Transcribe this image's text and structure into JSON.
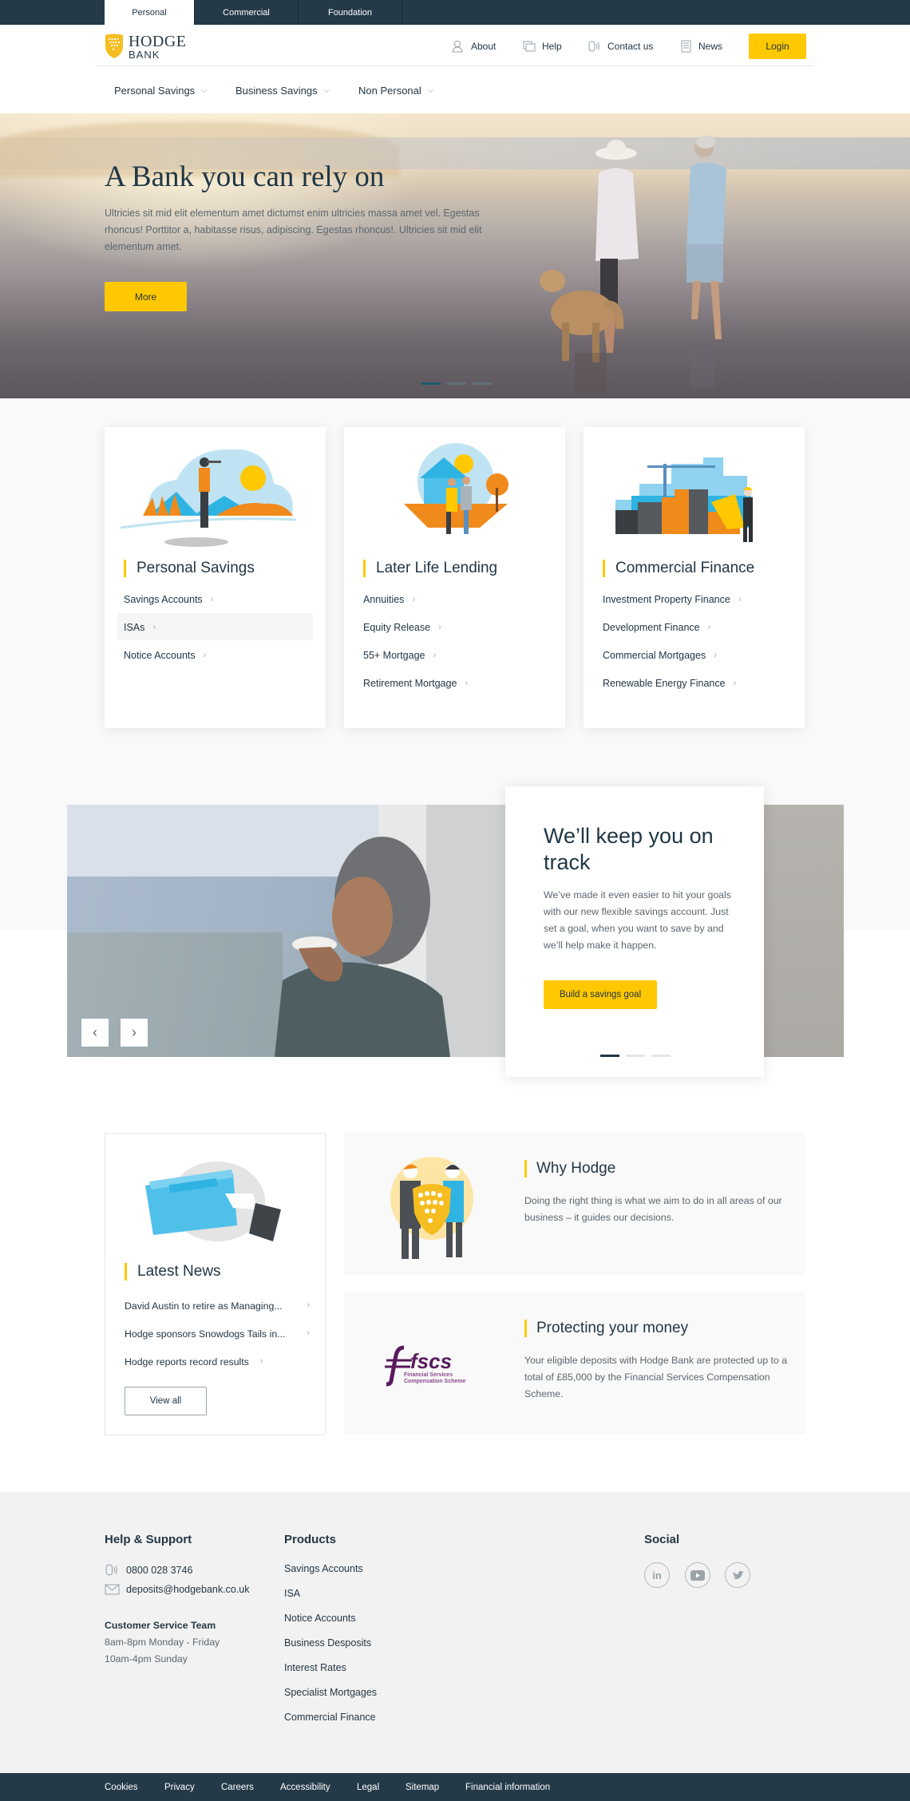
{
  "top_tabs": [
    {
      "label": "Personal",
      "active": true
    },
    {
      "label": "Commercial",
      "active": false
    },
    {
      "label": "Foundation",
      "active": false
    }
  ],
  "brand": {
    "name_top": "HODGE",
    "name_bottom": "BANK",
    "accent_color": "#ffc800",
    "dark_color": "#243a48"
  },
  "utility_nav": [
    {
      "label": "About",
      "icon": "people-icon"
    },
    {
      "label": "Help",
      "icon": "chat-icon"
    },
    {
      "label": "Contact us",
      "icon": "phone-icon"
    },
    {
      "label": "News",
      "icon": "newspaper-icon"
    }
  ],
  "login_label": "Login",
  "main_nav": [
    {
      "label": "Personal Savings"
    },
    {
      "label": "Business Savings"
    },
    {
      "label": "Non Personal"
    }
  ],
  "hero": {
    "title": "A Bank you can rely on",
    "text": "Ultricies sit mid elit elementum amet dictumst enim ultricies massa amet vel. Egestas rhoncus! Porttitor a, habitasse risus, adipiscing. Egestas rhoncus!. Ultricies sit mid elit elementum amet.",
    "button_label": "More",
    "slides": 3,
    "active_slide": 1
  },
  "product_cards": [
    {
      "title": "Personal Savings",
      "links": [
        "Savings Accounts",
        "ISAs",
        "Notice Accounts"
      ],
      "highlighted_link": 1
    },
    {
      "title": "Later Life Lending",
      "links": [
        "Annuities",
        "Equity Release",
        "55+ Mortgage",
        "Retirement Mortgage"
      ]
    },
    {
      "title": "Commercial Finance",
      "links": [
        "Investment Property Finance",
        "Development Finance",
        "Commercial Mortgages",
        "Renewable Energy Finance"
      ]
    }
  ],
  "promo": {
    "title": "We’ll keep you on track",
    "text": "We’ve made it even easier to hit your goals with our new flexible savings account. Just set a goal, when you want to save by and we’ll help make it happen.",
    "button_label": "Build a savings goal",
    "slides": 3,
    "active_slide": 1,
    "prev_label": "‹",
    "next_label": "›"
  },
  "news": {
    "title": "Latest News",
    "items": [
      "David Austin to retire as Managing...",
      "Hodge sponsors Snowdogs Tails in...",
      "Hodge reports record results"
    ],
    "view_all_label": "View all"
  },
  "why_hodge": {
    "title": "Why Hodge",
    "text": "Doing the right thing is what we aim to do in all areas of our business – it guides our decisions."
  },
  "protecting": {
    "title": "Protecting your money",
    "text": "Your eligible deposits with Hodge Bank are protected up to a total of £85,000 by the Financial Services Compensation Scheme.",
    "logo_text": "fscs",
    "logo_sub1": "Financial Services",
    "logo_sub2": "Compensation Scheme"
  },
  "footer": {
    "help": {
      "heading": "Help & Support",
      "phone": "0800 028 3746",
      "email": "deposits@hodgebank.co.uk",
      "team_heading": "Customer Service Team",
      "hours_weekday": "8am-8pm Monday - Friday",
      "hours_sunday": "10am-4pm Sunday"
    },
    "products": {
      "heading": "Products",
      "links": [
        "Savings Accounts",
        "ISA",
        "Notice Accounts",
        "Business Desposits",
        "Interest Rates",
        "Specialist Mortgages",
        "Commercial Finance"
      ]
    },
    "social": {
      "heading": "Social",
      "items": [
        {
          "name": "linkedin",
          "glyph": "in"
        },
        {
          "name": "youtube",
          "glyph": "▶"
        },
        {
          "name": "twitter",
          "glyph": "🐦"
        }
      ]
    },
    "bottom_links": [
      "Cookies",
      "Privacy",
      "Careers",
      "Accessibility",
      "Legal",
      "Sitemap",
      "Financial information"
    ]
  }
}
